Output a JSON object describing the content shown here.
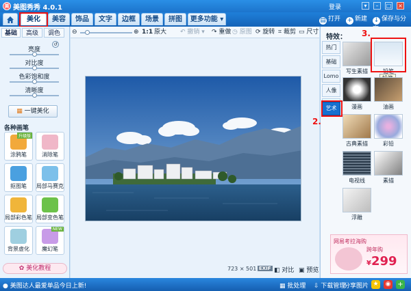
{
  "app": {
    "logo_text": "美",
    "title": "美图秀秀 4.0.1",
    "login": "登录",
    "window_buttons": [
      "▾",
      "–",
      "□",
      "×"
    ]
  },
  "tabs": {
    "home_icon": "home-icon",
    "items": [
      {
        "label": "美化",
        "active": true
      },
      {
        "label": "美容",
        "active": false
      },
      {
        "label": "饰品",
        "active": false
      },
      {
        "label": "文字",
        "active": false
      },
      {
        "label": "边框",
        "active": false
      },
      {
        "label": "场景",
        "active": false
      },
      {
        "label": "拼图",
        "active": false
      },
      {
        "label": "更多功能 ▾",
        "active": false
      }
    ]
  },
  "top_actions": {
    "open": "打开",
    "new": "新建",
    "save": "保存与分享"
  },
  "annotations": {
    "n1": "1.",
    "n2": "2.",
    "n3": "3."
  },
  "left_panel": {
    "subtabs": [
      "基础",
      "高级",
      "调色"
    ],
    "sliders": [
      {
        "label": "亮度",
        "value": 0.5
      },
      {
        "label": "对比度",
        "value": 0.5
      },
      {
        "label": "色彩饱和度",
        "value": 0.5
      },
      {
        "label": "清晰度",
        "value": 0.5
      }
    ],
    "one_click": "一键美化",
    "brush_title": "各种画笔",
    "tools": [
      {
        "label": "涂鸦笔",
        "badge": "升级版",
        "color": "#f2a93b"
      },
      {
        "label": "消除笔",
        "color": "#f0b7c8"
      },
      {
        "label": "抠图笔",
        "color": "#4aa0e0"
      },
      {
        "label": "局部马赛克",
        "color": "#7cc0ea"
      },
      {
        "label": "局部彩色笔",
        "color": "#f0b53a"
      },
      {
        "label": "局部变色笔",
        "color": "#6cc24a"
      },
      {
        "label": "背景虚化",
        "color": "#9fcfe0"
      },
      {
        "label": "魔幻笔",
        "badge": "NEW",
        "color": "#c89be8"
      }
    ],
    "tutorial": "美化教程"
  },
  "editor_toolbar": {
    "zoom_value": 0.1,
    "actual_ratio": "1:1",
    "original_size": "原大",
    "undo": "撤销",
    "redo": "重做",
    "restore": "原图",
    "rotate": "旋转",
    "crop": "裁剪",
    "resize": "尺寸"
  },
  "canvas": {
    "size_readout": "723 × 501",
    "exif_badge": "EXIF",
    "compare": "对比",
    "preview": "预览"
  },
  "right_panel": {
    "label": "特效：",
    "vtabs": [
      {
        "label": "热门",
        "active": false
      },
      {
        "label": "基础",
        "active": false
      },
      {
        "label": "Lomo",
        "active": false
      },
      {
        "label": "人像",
        "active": false
      },
      {
        "label": "时尚",
        "active": false
      },
      {
        "label": "艺术",
        "active": true
      }
    ],
    "effects": [
      {
        "label": "写生素描"
      },
      {
        "label": "铅笔",
        "tooltip": "铅笔",
        "highlighted": true
      },
      {
        "label": "漫画"
      },
      {
        "label": "油画"
      },
      {
        "label": "古典素描"
      },
      {
        "label": "彩铅"
      },
      {
        "label": "电视线"
      },
      {
        "label": "素描"
      },
      {
        "label": "浮雕"
      }
    ],
    "ad": {
      "header": "网易考拉海购",
      "promo": "跨年购",
      "price_symbol": "¥",
      "price": "299"
    }
  },
  "statusbar": {
    "message": "美图达人最爱单品今日上新!",
    "batch": "批处理",
    "download": "下载管理",
    "share": "分享图片"
  },
  "colors": {
    "accent": "#1670d0",
    "highlight": "#e11111",
    "titlebar": "#1c74cc"
  }
}
